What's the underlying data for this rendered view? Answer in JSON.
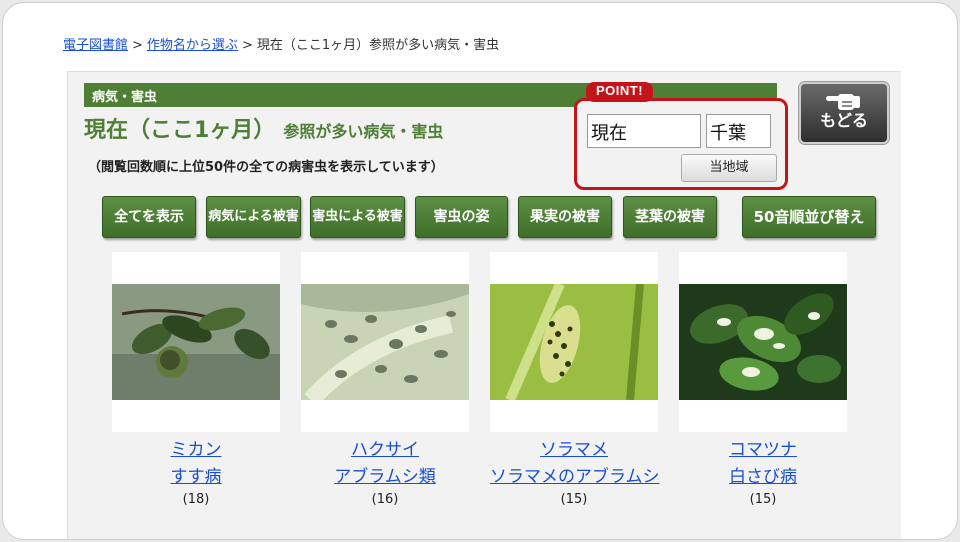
{
  "breadcrumb": {
    "items": [
      "電子図書館",
      "作物名から選ぶ"
    ],
    "separator": ">",
    "current": "現在（ここ1ヶ月）参照が多い病気・害虫"
  },
  "section": {
    "label": "病気・害虫"
  },
  "title": {
    "main": "現在（ここ1ヶ月）",
    "sub": "参照が多い病気・害虫"
  },
  "note": "（閲覧回数順に上位50件の全ての病害虫を表示しています）",
  "point": {
    "badge": "POINT!",
    "period": "現在",
    "region": "千葉",
    "area_button": "当地域"
  },
  "back_button": {
    "label": "もどる",
    "icon": "pointing-hand-icon"
  },
  "filters": [
    "全てを表示",
    "病気による被害",
    "害虫による被害",
    "害虫の姿",
    "果実の被害",
    "茎葉の被害",
    "50音順並び替え"
  ],
  "cards": [
    {
      "crop": "ミカン",
      "disease": "すす病",
      "count": "(18)"
    },
    {
      "crop": "ハクサイ",
      "disease": "アブラムシ類",
      "count": "(16)"
    },
    {
      "crop": "ソラマメ",
      "disease": "ソラマメのアブラムシ",
      "count": "(15)"
    },
    {
      "crop": "コマツナ",
      "disease": "白さび病",
      "count": "(15)"
    }
  ],
  "colors": {
    "accent_green": "#4e7f35",
    "point_red": "#c41419",
    "link_blue": "#1a4fd1"
  }
}
